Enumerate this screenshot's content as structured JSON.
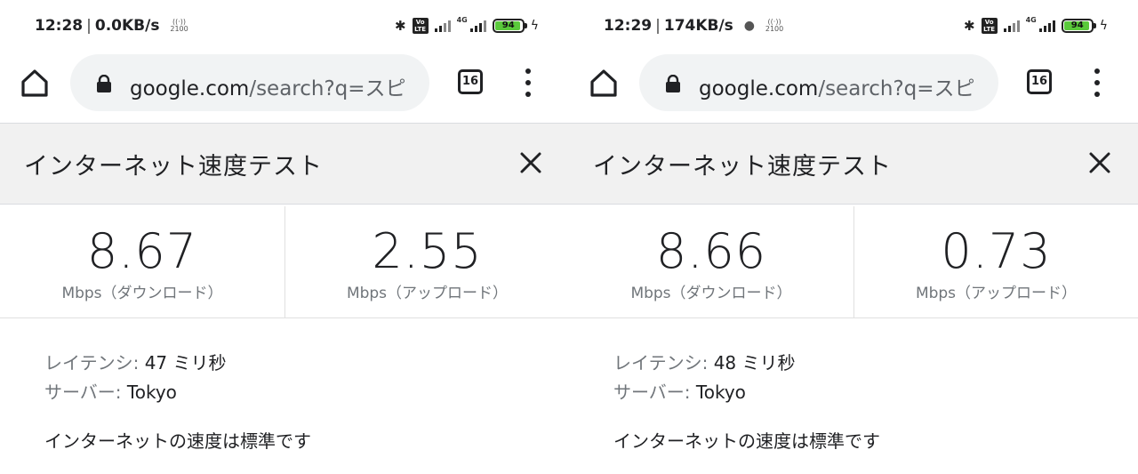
{
  "panes": [
    {
      "status": {
        "time": "12:28",
        "speed": "0.0KB/s",
        "aux_band": "2100",
        "volte": "Vo\nLTE",
        "net": "4G",
        "battery": "94"
      },
      "toolbar": {
        "url_host": "google.com",
        "url_rest": "/search?q=スピ",
        "tab_count": "16"
      },
      "card": {
        "title": "インターネット速度テスト",
        "download_value": "8.67",
        "download_label": "Mbps（ダウンロード）",
        "upload_value": "2.55",
        "upload_label": "Mbps（アップロード）",
        "latency_key": "レイテンシ:",
        "latency_value": "47 ミリ秒",
        "server_key": "サーバー:",
        "server_value": "Tokyo",
        "verdict": "インターネットの速度は標準です"
      }
    },
    {
      "status": {
        "time": "12:29",
        "speed": "174KB/s",
        "aux_band": "2100",
        "volte": "Vo\nLTE",
        "net": "4G",
        "battery": "94"
      },
      "toolbar": {
        "url_host": "google.com",
        "url_rest": "/search?q=スピ",
        "tab_count": "16"
      },
      "card": {
        "title": "インターネット速度テスト",
        "download_value": "8.66",
        "download_label": "Mbps（ダウンロード）",
        "upload_value": "0.73",
        "upload_label": "Mbps（アップロード）",
        "latency_key": "レイテンシ:",
        "latency_value": "48 ミリ秒",
        "server_key": "サーバー:",
        "server_value": "Tokyo",
        "verdict": "インターネットの速度は標準です"
      }
    }
  ],
  "icons": {
    "home": "home-icon",
    "lock": "lock-icon",
    "tabs": "tab-switcher-icon",
    "menu": "overflow-menu-icon",
    "close": "close-icon",
    "bluetooth": "bluetooth-icon",
    "signal": "signal-icon",
    "battery": "battery-icon",
    "charging": "charging-bolt-icon",
    "hotspot": "hotspot-icon",
    "data_saver": "data-saver-drop-icon"
  },
  "colors": {
    "battery_fill": "#5ac93b",
    "header_bg": "#f1f1f1",
    "omnibox_bg": "#f1f3f4",
    "label_gray": "#70757a"
  }
}
